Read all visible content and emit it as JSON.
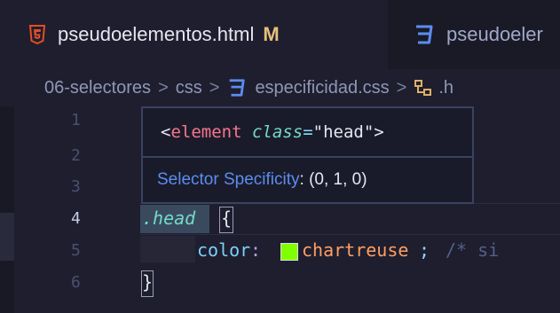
{
  "tabs": [
    {
      "title": "pseudoelementos.html",
      "modified": "M",
      "icon": "html5-icon",
      "active": true
    },
    {
      "title": "pseudoeler",
      "icon": "css3-icon",
      "active": false
    }
  ],
  "breadcrumb": {
    "folder": "06-selectores",
    "subfolder": "css",
    "file": "especificidad.css",
    "symbol": ".h",
    "separator": ">"
  },
  "hover": {
    "element_tag_open": "<",
    "element_name": "element",
    "attr_name": "class",
    "equals": "=",
    "attr_value": "\"head\"",
    "tag_close": ">",
    "specificity_label": "Selector Specificity",
    "specificity_colon": ":",
    "specificity_value": "(0, 1, 0)"
  },
  "line_numbers": [
    "1",
    "2",
    "3",
    "4",
    "5",
    "6"
  ],
  "current_line": "4",
  "code": {
    "line4_selector": ".head",
    "line4_brace": "{",
    "line5_property": "color",
    "line5_colon": ":",
    "line5_value": "chartreuse",
    "line5_semicolon": ";",
    "line5_comment": "/* si",
    "line6_brace": "}"
  },
  "colors": {
    "background": "#1e1e2e",
    "html_icon": "#e44d26",
    "css_icon": "#5b8def",
    "modified": "#e5c07b",
    "selector": "#73daca",
    "keyword": "#7aa2f7",
    "attr": "#e0af68",
    "string": "#9ece6a",
    "swatch": "#7fff00"
  }
}
